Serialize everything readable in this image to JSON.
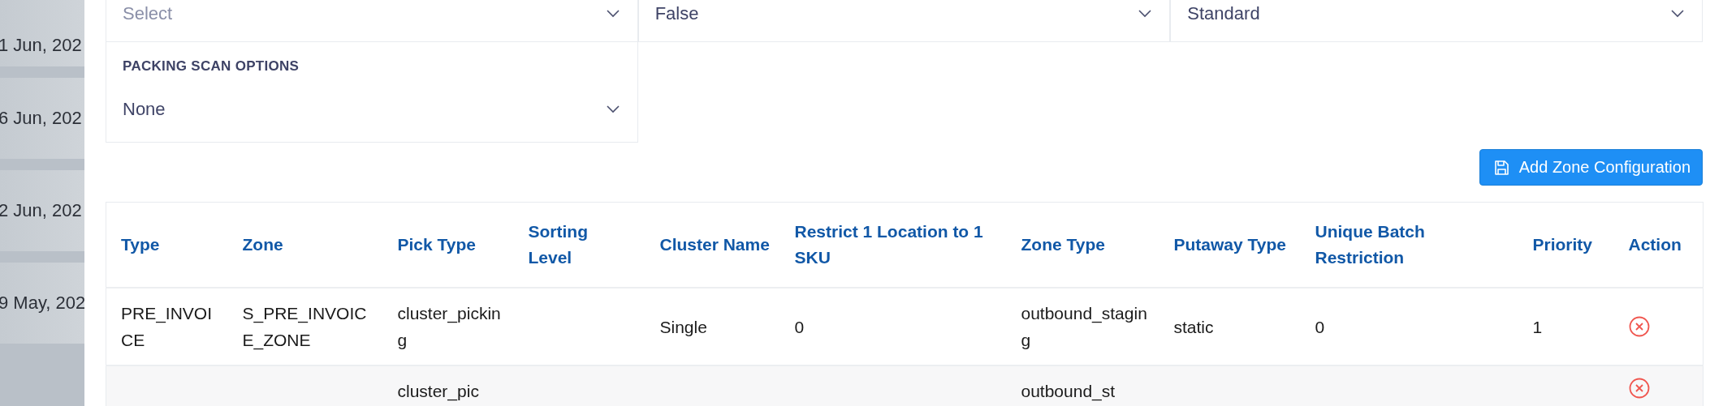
{
  "background_list": {
    "dates": [
      "1 Jun, 202",
      "6 Jun, 202",
      "2 Jun, 202",
      "9 May, 202"
    ]
  },
  "form": {
    "selects": [
      {
        "placeholder": "Select"
      },
      {
        "value": "False"
      },
      {
        "value": "Standard"
      }
    ],
    "packing_scan_options": {
      "label": "PACKING SCAN OPTIONS",
      "value": "None"
    }
  },
  "add_button": {
    "label": "Add Zone Configuration"
  },
  "table": {
    "columns": [
      "Type",
      "Zone",
      "Pick Type",
      "Sorting Level",
      "Cluster Name",
      "Restrict 1 Location to 1 SKU",
      "Zone Type",
      "Putaway Type",
      "Unique Batch Restriction",
      "Priority",
      "Action"
    ],
    "rows": [
      {
        "cells": [
          "PRE_INVOICE",
          "S_PRE_INVOICE_ZONE",
          "cluster_picking",
          null,
          "Single",
          "0",
          "outbound_staging",
          "static",
          "0",
          "1"
        ]
      },
      {
        "cells": [
          null,
          null,
          "cluster_pic",
          null,
          null,
          null,
          "outbound_st",
          null,
          null,
          null
        ]
      }
    ]
  }
}
